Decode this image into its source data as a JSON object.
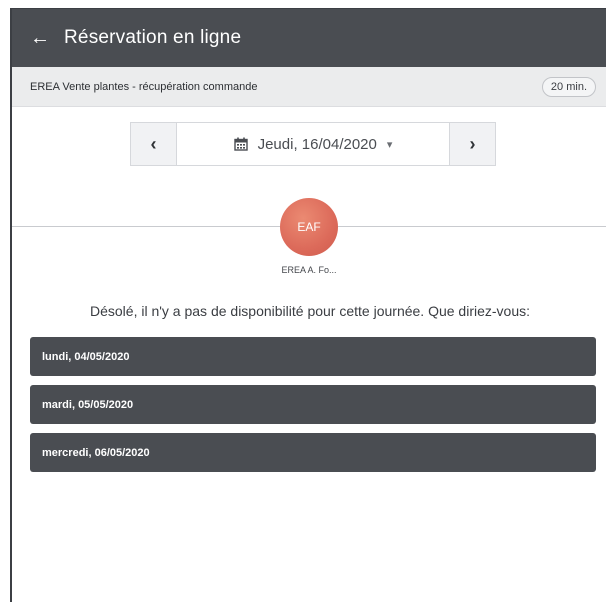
{
  "header": {
    "title": "Réservation en ligne",
    "back_icon": "arrow-left-icon"
  },
  "service": {
    "name": "EREA Vente plantes - récupération commande",
    "duration": "20 min."
  },
  "date_nav": {
    "prev_label": "‹",
    "next_label": "›",
    "current_date": "Jeudi, 16/04/2020",
    "calendar_icon": "calendar-icon",
    "chevron_icon": "chevron-down-icon"
  },
  "staff": {
    "initials": "EAF",
    "name": "EREA A. Fo...",
    "avatar_color": "#dc6a5a"
  },
  "message": "Désolé, il n'y a pas de disponibilité pour cette journée. Que diriez-vous:",
  "suggestions": [
    {
      "label": "lundi, 04/05/2020"
    },
    {
      "label": "mardi, 05/05/2020"
    },
    {
      "label": "mercredi, 06/05/2020"
    }
  ],
  "colors": {
    "header_bg": "#4a4d52",
    "subbar_bg": "#ebeced",
    "suggestion_bg": "#4a4d52",
    "avatar": "#dc6a5a"
  }
}
